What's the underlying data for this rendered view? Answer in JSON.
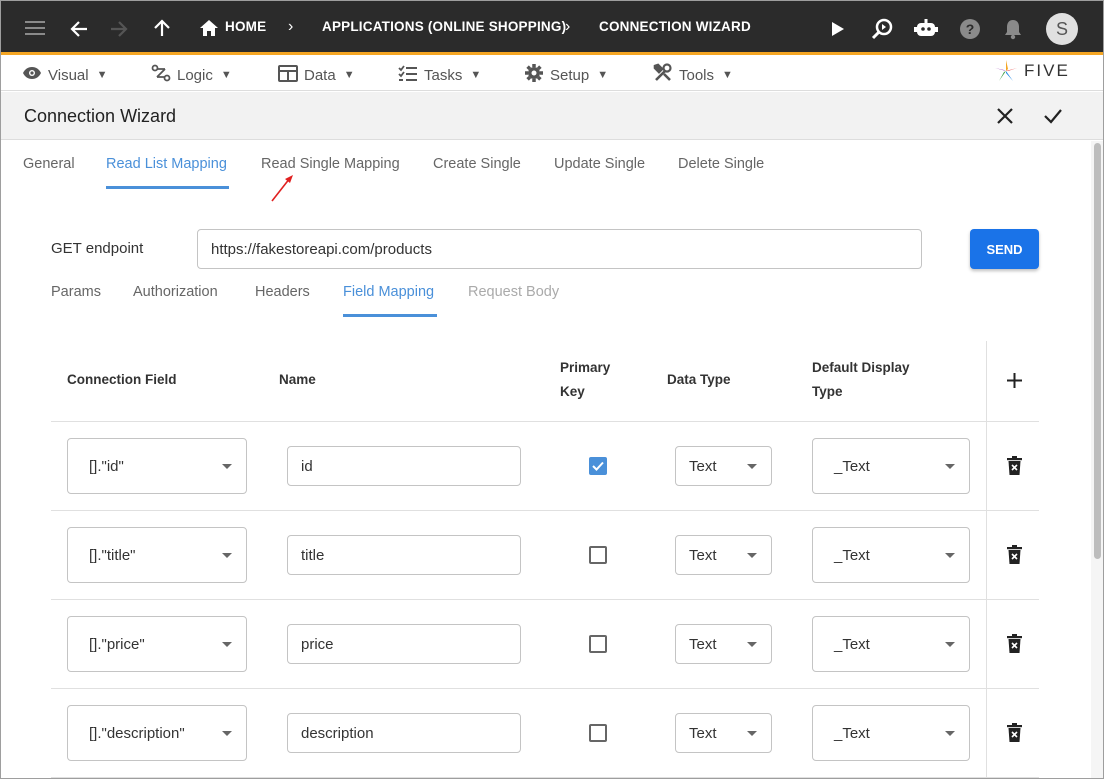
{
  "appbar": {
    "breadcrumbs": [
      "HOME",
      "APPLICATIONS (ONLINE SHOPPING)",
      "CONNECTION WIZARD"
    ],
    "avatar_letter": "S"
  },
  "menubar": {
    "items": [
      "Visual",
      "Logic",
      "Data",
      "Tasks",
      "Setup",
      "Tools"
    ],
    "caret": "▼",
    "logo_text": "FIVE"
  },
  "panel": {
    "title": "Connection Wizard"
  },
  "tabs": [
    "General",
    "Read List Mapping",
    "Read Single Mapping",
    "Create Single",
    "Update Single",
    "Delete Single"
  ],
  "active_tab": "Read List Mapping",
  "endpoint": {
    "label": "GET endpoint",
    "value": "https://fakestoreapi.com/products",
    "send_label": "SEND"
  },
  "subtabs": [
    "Params",
    "Authorization",
    "Headers",
    "Field Mapping",
    "Request Body"
  ],
  "active_subtab": "Field Mapping",
  "disabled_subtab": "Request Body",
  "table": {
    "headers": {
      "connection_field": "Connection Field",
      "name": "Name",
      "primary_key_1": "Primary",
      "primary_key_2": "Key",
      "data_type": "Data Type",
      "display_type_1": "Default Display",
      "display_type_2": "Type"
    },
    "rows": [
      {
        "field": "[].\"id\"",
        "name": "id",
        "primary": true,
        "data_type": "Text",
        "display_type": "_Text"
      },
      {
        "field": "[].\"title\"",
        "name": "title",
        "primary": false,
        "data_type": "Text",
        "display_type": "_Text"
      },
      {
        "field": "[].\"price\"",
        "name": "price",
        "primary": false,
        "data_type": "Text",
        "display_type": "_Text"
      },
      {
        "field": "[].\"description\"",
        "name": "description",
        "primary": false,
        "data_type": "Text",
        "display_type": "_Text"
      }
    ]
  },
  "colors": {
    "appbar_bg": "#2b2b2b",
    "appbar_accent": "#f5a623",
    "active_tab": "#4a90d9",
    "send_button": "#1a73e8",
    "annotation_arrow": "#e02020"
  }
}
